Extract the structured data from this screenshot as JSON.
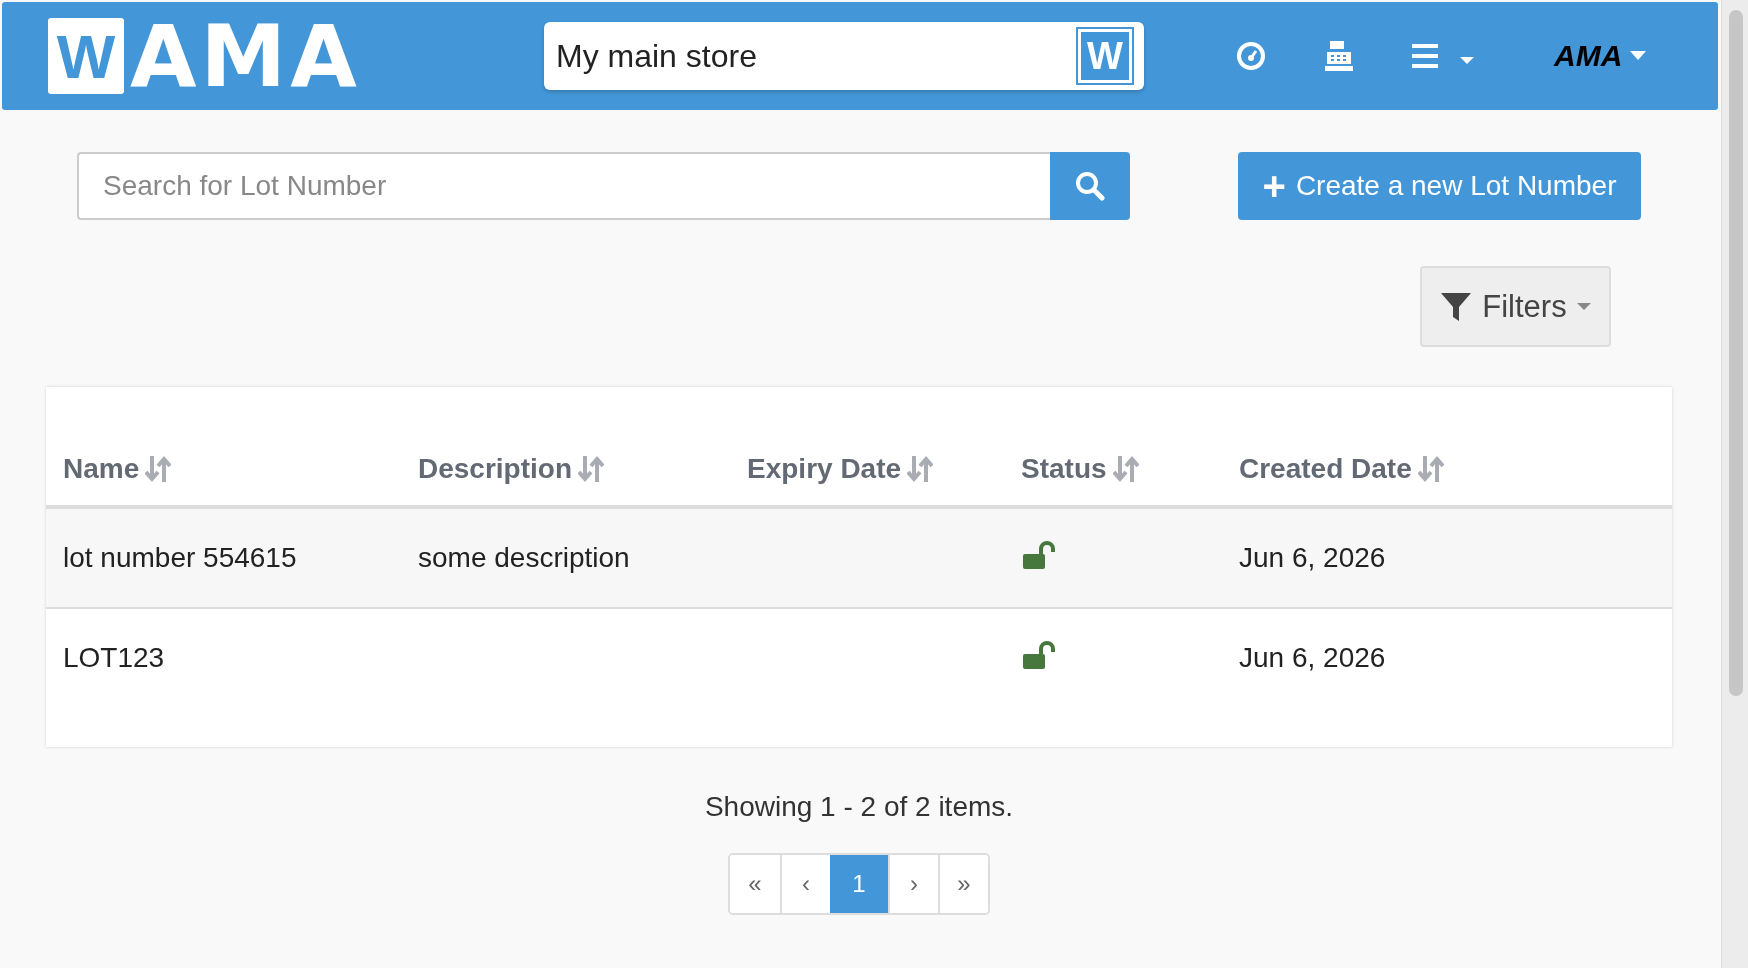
{
  "header": {
    "logo": {
      "boxed": "W",
      "text": "AMA"
    },
    "store": {
      "value": "My main store",
      "badge": "W"
    },
    "user": {
      "text": "AMA"
    }
  },
  "search": {
    "placeholder": "Search for Lot Number"
  },
  "create_button": {
    "icon": "+",
    "label": "Create a new Lot Number"
  },
  "filters_button": {
    "label": "Filters"
  },
  "table": {
    "columns": [
      "Name",
      "Description",
      "Expiry Date",
      "Status",
      "Created Date"
    ],
    "rows": [
      {
        "name": "lot number 554615",
        "description": "some description",
        "expiry_date": "",
        "locked": false,
        "created_date": "Jun 6, 2026"
      },
      {
        "name": "LOT123",
        "description": "",
        "expiry_date": "",
        "locked": false,
        "created_date": "Jun 6, 2026"
      }
    ]
  },
  "summary": "Showing 1 - 2 of 2 items.",
  "pagination": [
    {
      "label": "«",
      "selected": false
    },
    {
      "label": "‹",
      "selected": false
    },
    {
      "label": "1",
      "selected": true
    },
    {
      "label": "›",
      "selected": false
    },
    {
      "label": "»",
      "selected": false
    }
  ]
}
